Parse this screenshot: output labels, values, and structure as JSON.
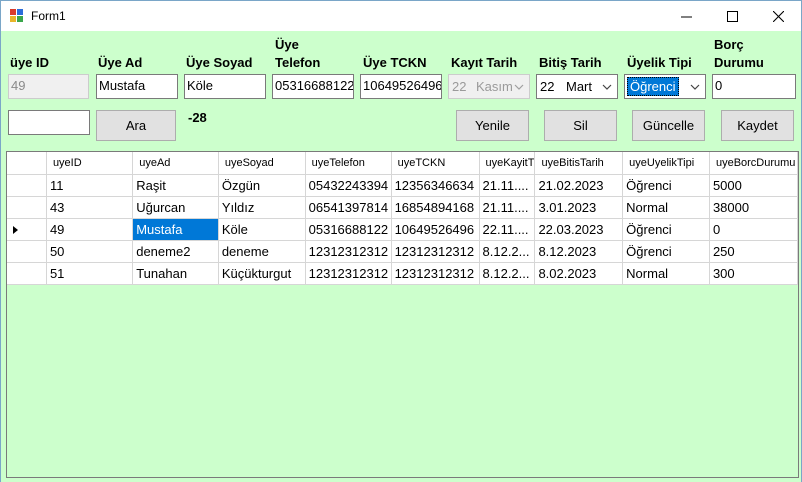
{
  "window": {
    "title": "Form1"
  },
  "labels": {
    "uye_id": "üye ID",
    "uye_ad": "Üye Ad",
    "uye_soyad": "Üye Soyad",
    "uye_telefon_1": "Üye",
    "uye_telefon_2": "Telefon",
    "uye_tckn": "Üye TCKN",
    "kayit_tarih": "Kayıt Tarih",
    "bitis_tarih": "Bitiş Tarih",
    "uyelik_tipi": "Üyelik Tipi",
    "borc_1": "Borç",
    "borc_2": "Durumu"
  },
  "fields": {
    "uye_id": "49",
    "uye_ad": "Mustafa",
    "uye_soyad": "Köle",
    "uye_telefon": "05316688122",
    "uye_tckn": "10649526496",
    "kayit_day": "22",
    "kayit_month": "Kasım",
    "bitis_day": "22",
    "bitis_month": "Mart",
    "uyelik_tipi": "Öğrenci",
    "borc": "0",
    "search": ""
  },
  "buttons": {
    "ara": "Ara",
    "yenile": "Yenile",
    "sil": "Sil",
    "guncelle": "Güncelle",
    "kaydet": "Kaydet"
  },
  "result_label": "-28",
  "grid": {
    "columns": [
      "uyeID",
      "uyeAd",
      "uyeSoyad",
      "uyeTelefon",
      "uyeTCKN",
      "uyeKayitT",
      "uyeBitisTarih",
      "uyeUyelikTipi",
      "uyeBorcDurumu"
    ],
    "rows": [
      [
        "11",
        "Raşit",
        "Özgün",
        "05432243394",
        "12356346634",
        "21.11....",
        "21.02.2023",
        "Öğrenci",
        "5000"
      ],
      [
        "43",
        "Uğurcan",
        "Yıldız",
        "06541397814",
        "16854894168",
        "21.11....",
        "3.01.2023",
        "Normal",
        "38000"
      ],
      [
        "49",
        "Mustafa",
        "Köle",
        "05316688122",
        "10649526496",
        "22.11....",
        "22.03.2023",
        "Öğrenci",
        "0"
      ],
      [
        "50",
        "deneme2",
        "deneme",
        "12312312312",
        "12312312312",
        "8.12.2...",
        "8.12.2023",
        "Öğrenci",
        "250"
      ],
      [
        "51",
        "Tunahan",
        "Küçükturgut",
        "12312312312",
        "12312312312",
        "8.12.2...",
        "8.02.2023",
        "Normal",
        "300"
      ]
    ]
  },
  "icons": {
    "app": "app-form-icon",
    "minimize": "minimize-icon",
    "maximize": "maximize-icon",
    "close": "close-icon"
  }
}
